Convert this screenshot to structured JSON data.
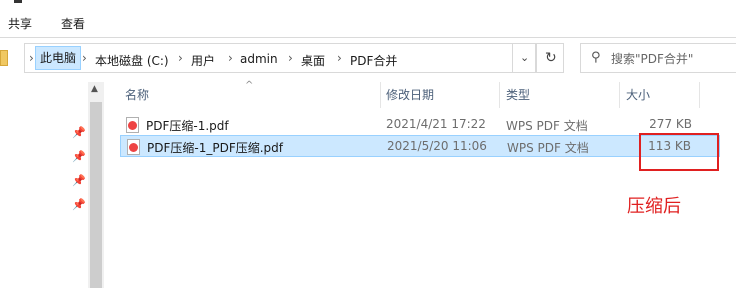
{
  "ribbon": {
    "tabs": [
      "共享",
      "查看"
    ]
  },
  "address": {
    "crumbs": [
      "此电脑",
      "本地磁盘 (C:)",
      "用户",
      "admin",
      "桌面",
      "PDF合并"
    ]
  },
  "search": {
    "placeholder": "搜索\"PDF合并\""
  },
  "columns": {
    "name": "名称",
    "date": "修改日期",
    "type": "类型",
    "size": "大小"
  },
  "files": [
    {
      "name": "PDF压缩-1.pdf",
      "date": "2021/4/21 17:22",
      "type": "WPS PDF 文档",
      "size": "277 KB"
    },
    {
      "name": "PDF压缩-1_PDF压缩.pdf",
      "date": "2021/5/20 11:06",
      "type": "WPS PDF 文档",
      "size": "113 KB"
    }
  ],
  "annotation": "压缩后",
  "colors": {
    "selection": "#cce8ff",
    "annotation": "#e02020",
    "header_text": "#4c607a"
  }
}
